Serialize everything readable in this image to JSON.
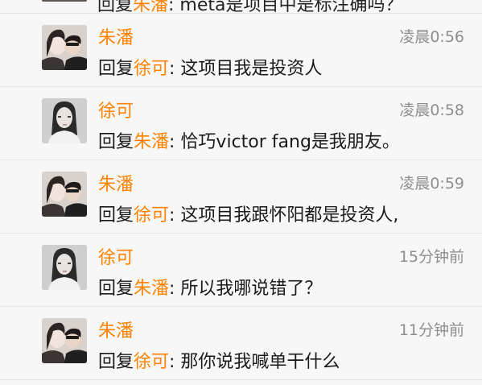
{
  "cropped_comment": {
    "text": "回复朱潘: meta是项目中是标注确吗？",
    "reply_word": "回复",
    "target": "朱潘",
    "rest": ": meta是项目中是标注确吗？"
  },
  "comments": [
    {
      "author": "朱潘",
      "time": "凌晨0:56",
      "reply_prefix": "回复",
      "reply_to": "徐可",
      "body": ": 这项目我是投资人",
      "avatar": "couple-photo-icon"
    },
    {
      "author": "徐可",
      "time": "凌晨0:58",
      "reply_prefix": "回复",
      "reply_to": "朱潘",
      "body": ": 恰巧victor fang是我朋友。",
      "avatar": "woman-portrait-icon"
    },
    {
      "author": "朱潘",
      "time": "凌晨0:59",
      "reply_prefix": "回复",
      "reply_to": "徐可",
      "body": ": 这项目我跟怀阳都是投资人,",
      "avatar": "couple-photo-icon"
    },
    {
      "author": "徐可",
      "time": "15分钟前",
      "reply_prefix": "回复",
      "reply_to": "朱潘",
      "body": ": 所以我哪说错了？",
      "avatar": "woman-portrait-icon"
    },
    {
      "author": "朱潘",
      "time": "11分钟前",
      "reply_prefix": "回复",
      "reply_to": "徐可",
      "body": ": 那你说我喊单干什么",
      "avatar": "couple-photo-icon"
    }
  ],
  "colors": {
    "accent": "#ff8200",
    "background": "#f7f7f7",
    "divider": "#e4e4e4",
    "time": "#8e8e8e"
  }
}
